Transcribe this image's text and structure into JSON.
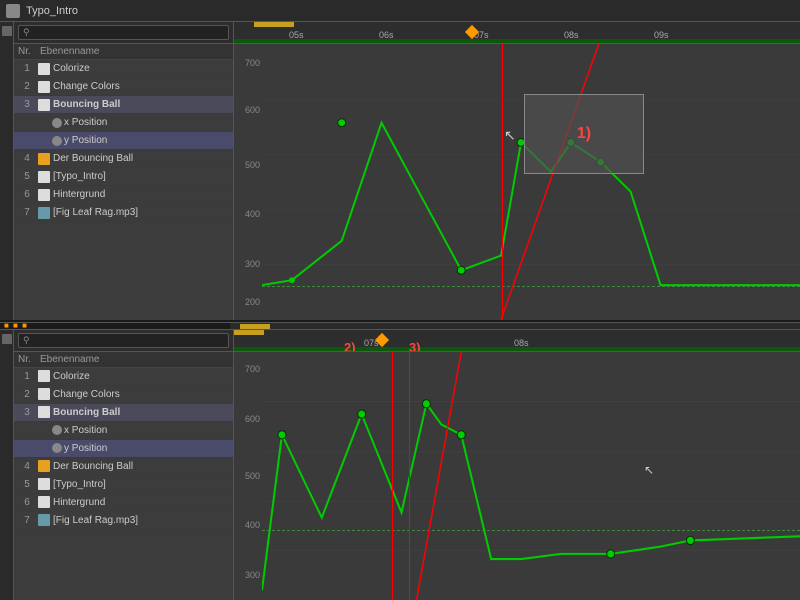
{
  "app": {
    "title": "Typo_Intro"
  },
  "panel1": {
    "toolbar": {
      "search_placeholder": ""
    },
    "header": {
      "nr": "Nr.",
      "name": "Ebenenname"
    },
    "layers": [
      {
        "nr": "1",
        "icon": "white",
        "name": "Colorize",
        "indent": 0
      },
      {
        "nr": "2",
        "icon": "white",
        "name": "Change Colors",
        "indent": 0
      },
      {
        "nr": "3",
        "icon": "white",
        "name": "Bouncing Ball",
        "indent": 0,
        "selected": true
      },
      {
        "nr": "",
        "icon": "blue",
        "name": "x Position",
        "indent": 1
      },
      {
        "nr": "",
        "icon": "blue",
        "name": "y Position",
        "indent": 1,
        "highlighted": true
      },
      {
        "nr": "4",
        "icon": "orange",
        "name": "Der Bouncing Ball",
        "indent": 0
      },
      {
        "nr": "5",
        "icon": "white",
        "name": "[Typo_Intro]",
        "indent": 0
      },
      {
        "nr": "6",
        "icon": "white",
        "name": "Hintergrund",
        "indent": 0
      },
      {
        "nr": "7",
        "icon": "blue",
        "name": "[Fig Leaf Rag.mp3]",
        "indent": 0
      }
    ],
    "ruler": {
      "marks": [
        "05s",
        "06s",
        "07s",
        "08s",
        "09s"
      ]
    },
    "y_labels": [
      "700",
      "600",
      "500",
      "400",
      "300",
      "200"
    ],
    "annotation": "1)"
  },
  "panel2": {
    "toolbar": {
      "search_placeholder": ""
    },
    "header": {
      "nr": "Nr.",
      "name": "Ebenenname"
    },
    "layers": [
      {
        "nr": "1",
        "icon": "white",
        "name": "Colorize",
        "indent": 0
      },
      {
        "nr": "2",
        "icon": "white",
        "name": "Change Colors",
        "indent": 0
      },
      {
        "nr": "3",
        "icon": "white",
        "name": "Bouncing Ball",
        "indent": 0,
        "selected": true
      },
      {
        "nr": "",
        "icon": "blue",
        "name": "x Position",
        "indent": 1
      },
      {
        "nr": "",
        "icon": "blue",
        "name": "y Position",
        "indent": 1,
        "highlighted": true
      },
      {
        "nr": "4",
        "icon": "orange",
        "name": "Der Bouncing Ball",
        "indent": 0
      },
      {
        "nr": "5",
        "icon": "white",
        "name": "[Typo_Intro]",
        "indent": 0
      },
      {
        "nr": "6",
        "icon": "white",
        "name": "Hintergrund",
        "indent": 0
      },
      {
        "nr": "7",
        "icon": "blue",
        "name": "[Fig Leaf Rag.mp3]",
        "indent": 0
      }
    ],
    "ruler": {
      "marks": [
        "07s",
        "08s"
      ]
    },
    "y_labels": [
      "700",
      "600",
      "500",
      "400",
      "300"
    ],
    "annotations": [
      "2)",
      "3)"
    ]
  }
}
